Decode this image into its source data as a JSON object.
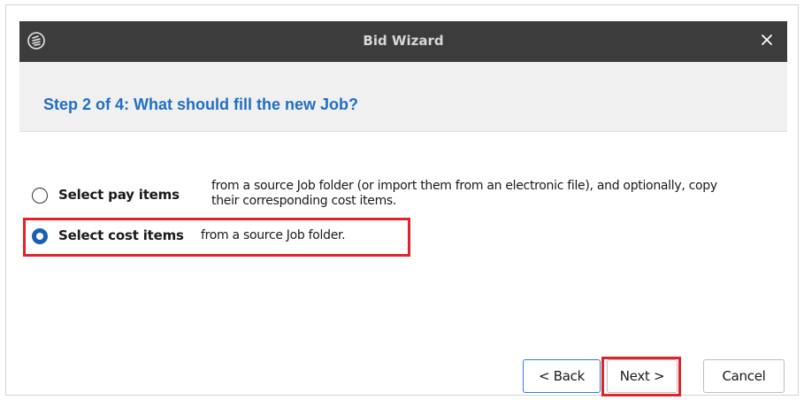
{
  "window": {
    "title": "Bid Wizard",
    "close_glyph": "✕",
    "app_icon": "bid-wizard-logo-icon"
  },
  "header": {
    "step_title": "Step 2 of 4: What should fill the new Job?"
  },
  "options": [
    {
      "label": "Select pay items",
      "description_line1": "from a source Job folder (or import them from an electronic file), and optionally, copy",
      "description_line2": "their corresponding cost items.",
      "selected": false
    },
    {
      "label": "Select cost items",
      "description_line1": "from a source Job folder.",
      "selected": true
    }
  ],
  "buttons": {
    "back": "< Back",
    "next": "Next >",
    "cancel": "Cancel"
  },
  "colors": {
    "titlebar": "#3c3c3c",
    "step_title": "#1f6fc5",
    "radio_selected": "#1b5fb0",
    "highlight": "#e0242b"
  }
}
